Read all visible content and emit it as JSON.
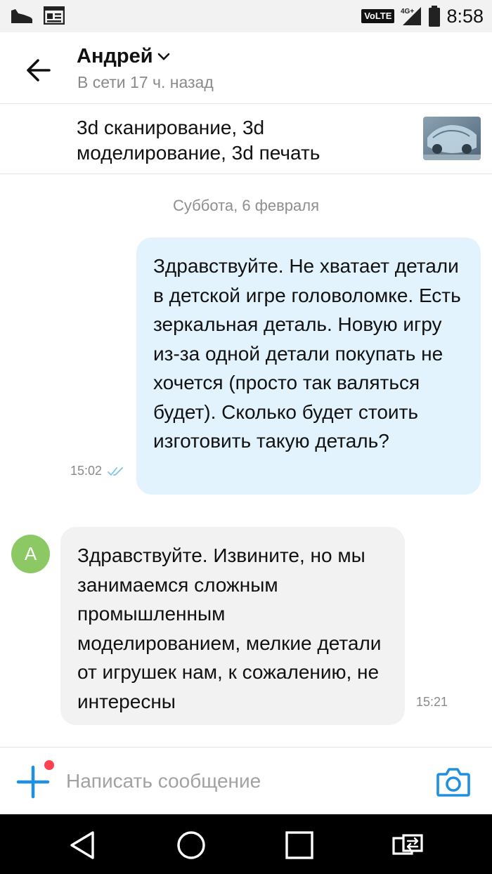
{
  "status_bar": {
    "left_icons": [
      "sneaker-icon",
      "news-icon"
    ],
    "network": "VoLTE",
    "signal_label": "4G+",
    "time": "8:58"
  },
  "header": {
    "back_icon": "arrow-left-icon",
    "contact_name": "Андрей",
    "dropdown_icon": "chevron-down-icon",
    "online_status": "В сети 17 ч. назад"
  },
  "listing": {
    "title": "3d сканирование, 3d моделирование, 3d печать",
    "thumbnail": "car-scan-thumbnail"
  },
  "chat": {
    "date_separator": "Суббота, 6 февраля",
    "messages": [
      {
        "direction": "outgoing",
        "text": "Здравствуйте. Не хватает детали в детской игре головоломке. Есть зеркальная деталь. Новую игру из-за одной детали покупать не хочется (просто так валяться будет). Сколько будет стоить изготовить такую деталь?",
        "time": "15:02",
        "read_icon": "double-check-icon"
      },
      {
        "direction": "incoming",
        "avatar_letter": "А",
        "text": "Здравствуйте. Извините, но мы занимаемся сложным промышленным моделированием, мелкие детали от игрушек нам, к сожалению, не интересны",
        "time": "15:21"
      }
    ]
  },
  "composer": {
    "placeholder": "Написать сообщение",
    "value": ""
  },
  "colors": {
    "accent": "#1e8fe1",
    "outgoing_bubble": "#e2f3fd",
    "incoming_bubble": "#f2f2f2",
    "avatar": "#8cc864",
    "notification_dot": "#ff4053"
  }
}
